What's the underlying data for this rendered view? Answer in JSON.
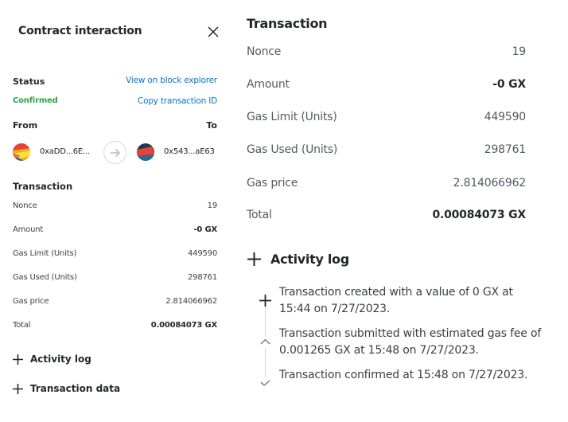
{
  "header": {
    "title": "Contract interaction",
    "close_icon": "close-icon"
  },
  "status": {
    "label": "Status",
    "value": "Confirmed",
    "value_color": "#28a745",
    "view_explorer_link": "View on block explorer",
    "copy_id_link": "Copy transaction ID",
    "link_color": "#0376c9"
  },
  "parties": {
    "from_label": "From",
    "to_label": "To",
    "from_address": "0xaDD...6E...",
    "to_address": "0x543...aE63",
    "arrow_icon": "arrow-right-icon"
  },
  "transaction": {
    "title": "Transaction",
    "rows": [
      {
        "label": "Nonce",
        "value": "19",
        "bold": false
      },
      {
        "label": "Amount",
        "value": "-0 GX",
        "bold": true
      },
      {
        "label": "Gas Limit (Units)",
        "value": "449590",
        "bold": false
      },
      {
        "label": "Gas Used (Units)",
        "value": "298761",
        "bold": false
      },
      {
        "label": "Gas price",
        "value": "2.814066962",
        "bold": false
      },
      {
        "label": "Total",
        "value": "0.00084073 GX",
        "bold": true
      }
    ]
  },
  "sections": {
    "activity_log": "Activity log",
    "transaction_data": "Transaction data"
  },
  "activity_log": {
    "entries": [
      {
        "icon": "plus-icon",
        "text": "Transaction created with a value of 0 GX at 15:44 on 7/27/2023."
      },
      {
        "icon": "chevron-up-icon",
        "text": "Transaction submitted with estimated gas fee of 0.001265 GX at 15:48 on 7/27/2023."
      },
      {
        "icon": "check-icon",
        "text": "Transaction confirmed at 15:48 on 7/27/2023."
      }
    ]
  }
}
